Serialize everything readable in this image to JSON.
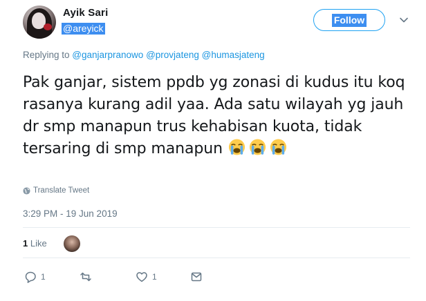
{
  "user": {
    "name": "Ayik Sari",
    "handle": "@areyick"
  },
  "follow_label": "Follow",
  "reply_prefix": "Replying to ",
  "mentions": [
    "@ganjarpranowo",
    "@provjateng",
    "@humasjateng"
  ],
  "tweet_text": "Pak ganjar, sistem ppdb yg zonasi di kudus itu koq rasanya kurang adil yaa. Ada satu wilayah yg jauh dr smp manapun trus kehabisan kuota, tidak tersaring di smp manapun",
  "emojis": [
    "loudly-crying-face-icon",
    "loudly-crying-face-icon",
    "loudly-crying-face-icon"
  ],
  "translate_label": "Translate Tweet",
  "timestamp": "3:29 PM - 19 Jun 2019",
  "likes_count": "1",
  "likes_label": "Like",
  "actions": {
    "reply_count": "1",
    "retweet_count": "",
    "like_count": "1"
  },
  "colors": {
    "link": "#1b95e0",
    "muted": "#657786",
    "follow_border": "#1da1f2",
    "selection": "#3d8ef0"
  }
}
